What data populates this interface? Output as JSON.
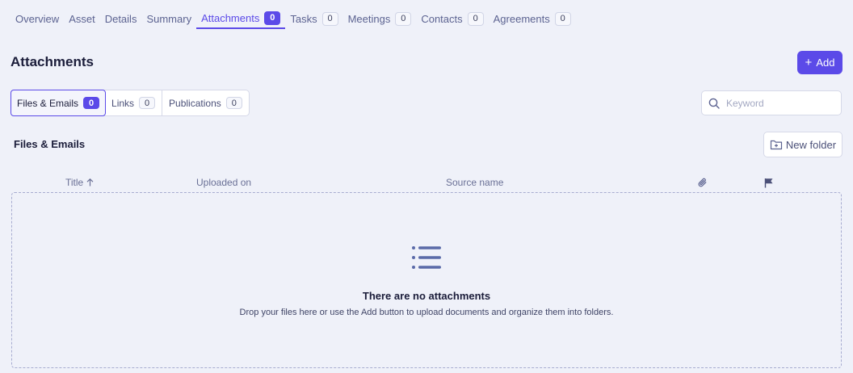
{
  "nav": {
    "tabs": [
      {
        "label": "Overview"
      },
      {
        "label": "Asset"
      },
      {
        "label": "Details"
      },
      {
        "label": "Summary"
      },
      {
        "label": "Attachments",
        "count": "0",
        "active": true
      },
      {
        "label": "Tasks",
        "count": "0"
      },
      {
        "label": "Meetings",
        "count": "0"
      },
      {
        "label": "Contacts",
        "count": "0"
      },
      {
        "label": "Agreements",
        "count": "0"
      }
    ]
  },
  "header": {
    "title": "Attachments",
    "add_label": "Add",
    "add_icon": "plus-icon"
  },
  "subtabs": [
    {
      "label": "Files & Emails",
      "count": "0",
      "active": true
    },
    {
      "label": "Links",
      "count": "0"
    },
    {
      "label": "Publications",
      "count": "0"
    }
  ],
  "search": {
    "placeholder": "Keyword",
    "value": "",
    "icon": "search-icon"
  },
  "section": {
    "title": "Files & Emails",
    "new_folder_label": "New folder",
    "new_folder_icon": "folder-plus-icon"
  },
  "table": {
    "columns": {
      "title": "Title",
      "uploaded_on": "Uploaded on",
      "source_name": "Source name"
    },
    "sort_icon": "arrow-up-icon",
    "attachment_icon": "paperclip-icon",
    "flag_icon": "flag-icon"
  },
  "empty": {
    "icon": "list-icon",
    "title": "There are no attachments",
    "description": "Drop your files here or use the Add button to upload documents and organize them into folders."
  },
  "colors": {
    "accent": "#5b4ae8",
    "background": "#eff1f9",
    "text": "#1b1d3a",
    "muted": "#5c6391"
  }
}
